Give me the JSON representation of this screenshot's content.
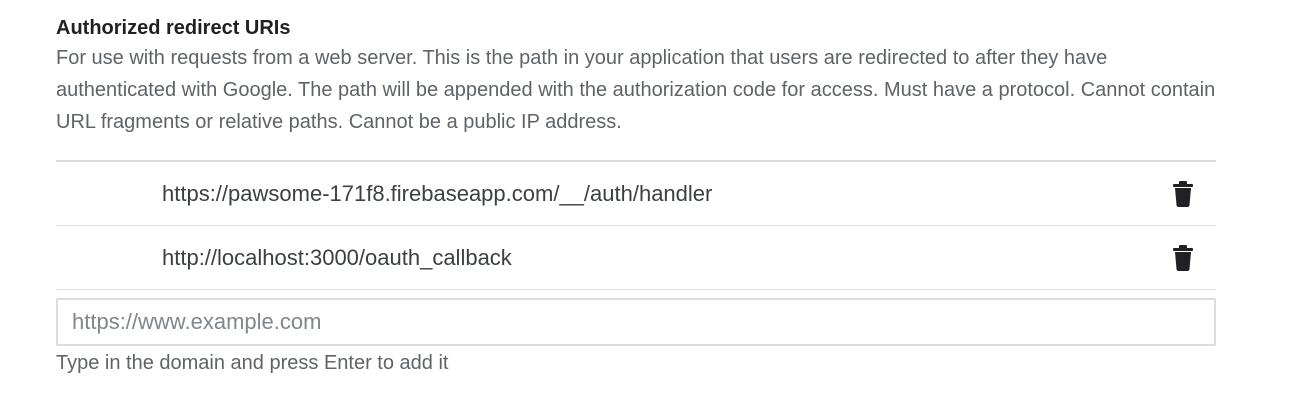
{
  "section": {
    "title": "Authorized redirect URIs",
    "description": "For use with requests from a web server. This is the path in your application that users are redirected to after they have authenticated with Google. The path will be appended with the authorization code for access. Must have a protocol. Cannot contain URL fragments or relative paths. Cannot be a public IP address."
  },
  "uris": [
    {
      "value": "https://pawsome-171f8.firebaseapp.com/__/auth/handler",
      "delete_icon": "trash-icon"
    },
    {
      "value": "http://localhost:3000/oauth_callback",
      "delete_icon": "trash-icon"
    }
  ],
  "new_uri": {
    "placeholder": "https://www.example.com",
    "value": "",
    "hint": "Type in the domain and press Enter to add it"
  },
  "colors": {
    "border": "#dadce0",
    "text": "#3c4043",
    "muted": "#5f6368",
    "icon": "#202124"
  }
}
